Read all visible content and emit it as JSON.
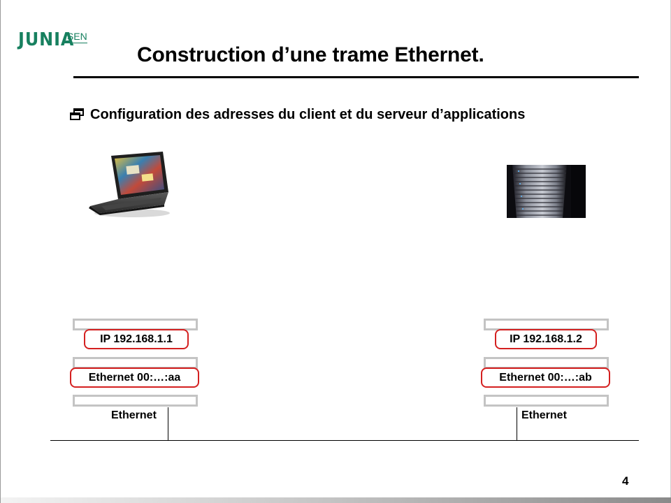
{
  "logo": {
    "brand": "JUNIA",
    "sub": "ISEN",
    "color": "#17805f"
  },
  "slide": {
    "title": "Construction d’une trame Ethernet.",
    "bullet": "Configuration des adresses du client et du serveur d’applications",
    "page_number": "4"
  },
  "client": {
    "ip_label": "IP 192.168.1.1",
    "mac_label": "Ethernet 00:…:aa",
    "link_label": "Ethernet"
  },
  "server": {
    "ip_label": "IP 192.168.1.2",
    "mac_label": "Ethernet 00:…:ab",
    "link_label": "Ethernet"
  },
  "colors": {
    "highlight_border": "#d42020",
    "layer_bar_border": "#c4c4c4",
    "text": "#000000"
  },
  "icons": {
    "bullet": "window-restore-icon",
    "client_device": "laptop-icon",
    "server_device": "server-rack-icon"
  }
}
